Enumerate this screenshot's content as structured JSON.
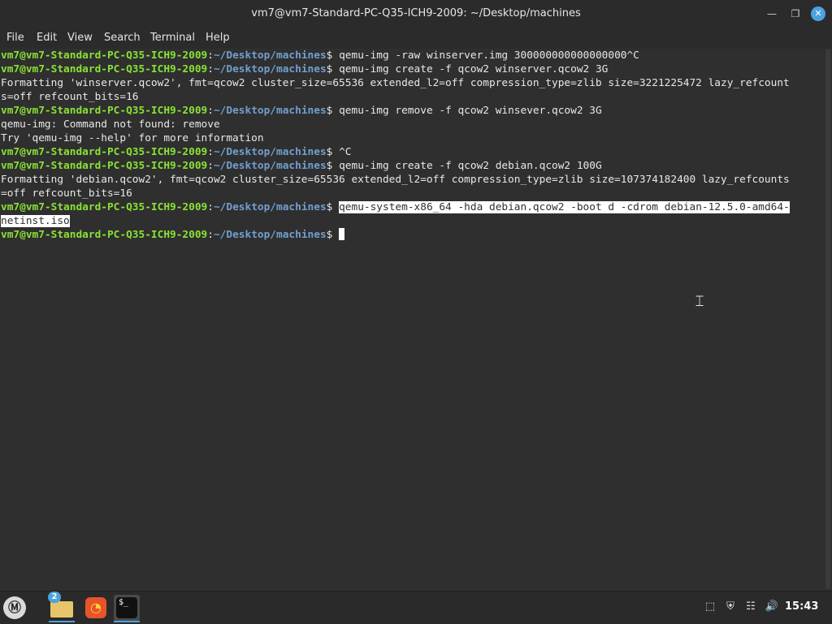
{
  "window": {
    "title": "vm7@vm7-Standard-PC-Q35-ICH9-2009: ~/Desktop/machines",
    "minimize_icon": "minimize-icon",
    "maximize_icon": "restore-icon",
    "close_icon": "close-icon"
  },
  "menubar": {
    "items": [
      "File",
      "Edit",
      "View",
      "Search",
      "Terminal",
      "Help"
    ]
  },
  "prompt": {
    "user": "vm7@vm7-Standard-PC-Q35-ICH9-2009",
    "sep": ":",
    "path": "~/Desktop/machines",
    "dollar": "$ "
  },
  "terminal": {
    "lines": [
      {
        "type": "prompt",
        "cmd": "qemu-img -raw winserver.img 300000000000000000^C"
      },
      {
        "type": "prompt",
        "cmd": "qemu-img create -f qcow2 winserver.qcow2 3G"
      },
      {
        "type": "out",
        "text": "Formatting 'winserver.qcow2', fmt=qcow2 cluster_size=65536 extended_l2=off compression_type=zlib size=3221225472 lazy_refcount"
      },
      {
        "type": "out",
        "text": "s=off refcount_bits=16"
      },
      {
        "type": "prompt",
        "cmd": "qemu-img remove -f qcow2 winsever.qcow2 3G"
      },
      {
        "type": "out",
        "text": "qemu-img: Command not found: remove"
      },
      {
        "type": "out",
        "text": "Try 'qemu-img --help' for more information"
      },
      {
        "type": "prompt",
        "cmd": "^C"
      },
      {
        "type": "prompt",
        "cmd": "qemu-img create -f qcow2 debian.qcow2 100G"
      },
      {
        "type": "out",
        "text": "Formatting 'debian.qcow2', fmt=qcow2 cluster_size=65536 extended_l2=off compression_type=zlib size=107374182400 lazy_refcounts"
      },
      {
        "type": "out",
        "text": "=off refcount_bits=16"
      },
      {
        "type": "prompt_sel",
        "cmd": "qemu-system-x86_64 -hda debian.qcow2 -boot d -cdrom debian-12.5.0-amd64-"
      },
      {
        "type": "out_sel",
        "text": "netinst.iso"
      },
      {
        "type": "prompt_cursor",
        "cmd": ""
      }
    ]
  },
  "taskbar": {
    "menu_icon": "linux-mint-menu-icon",
    "folder_badge": "2",
    "apps": [
      "files-folder-icon",
      "firefox-icon",
      "terminal-icon"
    ],
    "tray_icons": [
      "update-manager-icon",
      "shield-icon",
      "network-icon",
      "volume-icon"
    ],
    "clock": "15:43"
  },
  "colors": {
    "prompt_user": "#8ae234",
    "prompt_path": "#729fcf",
    "background": "#2f2f2f",
    "accent": "#4aa3df"
  }
}
